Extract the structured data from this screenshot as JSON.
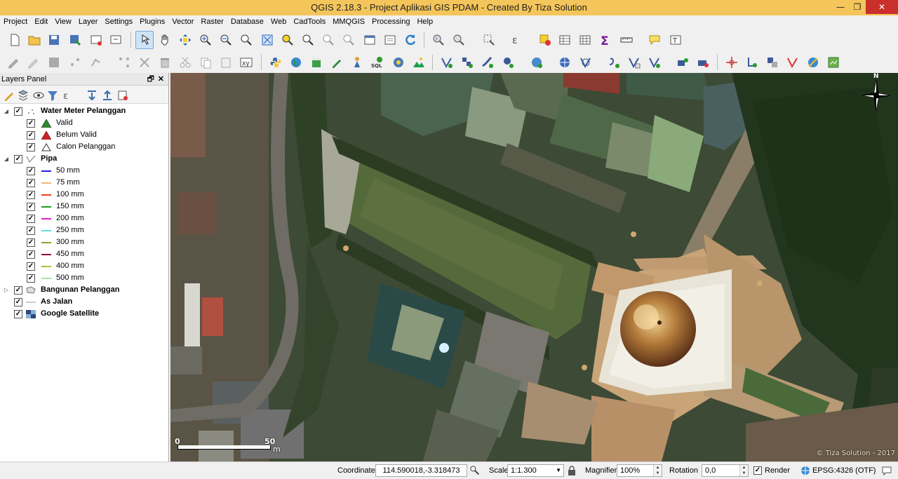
{
  "window": {
    "title": "QGIS 2.18.3 - Project Aplikasi GIS PDAM - Created By Tiza Solution",
    "minimize": "—",
    "restore": "❐",
    "close": "✕"
  },
  "menu": [
    "Project",
    "Edit",
    "View",
    "Layer",
    "Settings",
    "Plugins",
    "Vector",
    "Raster",
    "Database",
    "Web",
    "CadTools",
    "MMQGIS",
    "Processing",
    "Help"
  ],
  "layers_panel": {
    "title": "Layers Panel",
    "float": "🗗",
    "close": "✕",
    "layers": [
      {
        "label": "Water Meter Pelanggan",
        "group": true
      },
      {
        "label": "Valid",
        "symbol": "triangle",
        "color": "#2e8b2e"
      },
      {
        "label": "Belum Valid",
        "symbol": "triangle",
        "color": "#d42020"
      },
      {
        "label": "Calon Pelanggan",
        "symbol": "triangle-outline",
        "color": "#333333"
      },
      {
        "label": "Pipa",
        "group": true
      },
      {
        "label": "50 mm",
        "color": "#2020e0"
      },
      {
        "label": "75 mm",
        "color": "#f0b878"
      },
      {
        "label": "100 mm",
        "color": "#f04020"
      },
      {
        "label": "150 mm",
        "color": "#20a020"
      },
      {
        "label": "200 mm",
        "color": "#e020c0"
      },
      {
        "label": "250 mm",
        "color": "#60e0e0"
      },
      {
        "label": "300 mm",
        "color": "#90a030"
      },
      {
        "label": "450 mm",
        "color": "#901040"
      },
      {
        "label": "400 mm",
        "color": "#b0c040"
      },
      {
        "label": "500 mm",
        "color": "#b0e0b0"
      },
      {
        "label": "Bangunan Pelanggan",
        "group": true
      },
      {
        "label": "As Jalan",
        "group": true
      },
      {
        "label": "Google Satellite",
        "group": true
      }
    ]
  },
  "map": {
    "scalebar_start": "0",
    "scalebar_end": "50",
    "scalebar_unit": "m",
    "copyright": "© Tiza Solution - 2017",
    "north_label": "N"
  },
  "status": {
    "coordinate_label": "Coordinate",
    "coordinate_value": "114.590018,-3.318473",
    "scale_label": "Scale",
    "scale_value": "1:1.300",
    "magnifier_label": "Magnifier",
    "magnifier_value": "100%",
    "rotation_label": "Rotation",
    "rotation_value": "0,0",
    "render_label": "Render",
    "crs": "EPSG:4326 (OTF)"
  }
}
